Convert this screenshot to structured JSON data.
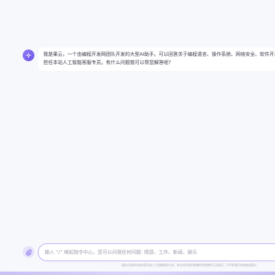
{
  "chat": {
    "messages": [
      {
        "role": "assistant",
        "avatar_icon": "sparkle-icon",
        "lines": [
          "我是果云，一个由编程开发网团队开发的大型AI助手。可以回答关于编程语言、操作系统、网络安全、软件开发",
          "担任本站人工智能客服专员。有什么问题我可以帮您解答呢?"
        ]
      }
    ]
  },
  "composer": {
    "attach_icon": "attachment-icon",
    "placeholder": "输入 “/” 唤起指令中心，您可以问我任何问题: 情感、工作、新闻、娱乐",
    "value": ""
  },
  "footer": {
    "disclaimer": "服务生成的所有内容均由人工智能模型生成，其生成内容的准确性和完整性无法保证，不代表我们的态度或观点"
  },
  "theme": {
    "accent": "#7b66ef",
    "background": "#f7f8fc",
    "bubble": "#ffffff",
    "input_border": "#b9acf5"
  }
}
